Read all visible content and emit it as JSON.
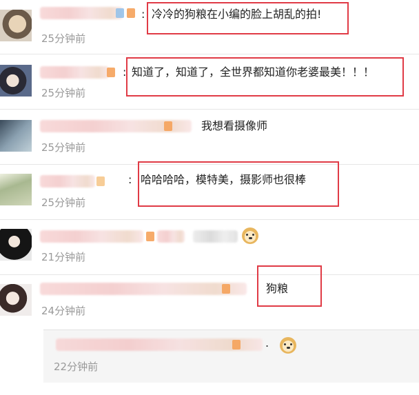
{
  "comments": [
    {
      "text": "冷冷的狗粮在小编的脸上胡乱的拍!",
      "prefix": ":",
      "time": "25分钟前",
      "highlighted": true
    },
    {
      "text": "知道了，知道了，全世界都知道你老婆最美！！！",
      "prefix": ":",
      "time": "25分钟前",
      "highlighted": true
    },
    {
      "text": "我想看摄像师",
      "prefix": "",
      "time": "25分钟前",
      "highlighted": false
    },
    {
      "text": "哈哈哈哈，模特美，摄影师也很棒",
      "prefix": ":",
      "time": "25分钟前",
      "highlighted": true
    },
    {
      "text": "",
      "prefix": "",
      "time": "21分钟前",
      "highlighted": false,
      "emoji": "doge-icon"
    },
    {
      "text": "狗粮",
      "prefix": "",
      "time": "24分钟前",
      "highlighted": true
    }
  ],
  "reply": {
    "time": "22分钟前",
    "emoji": "doge-icon"
  },
  "colors": {
    "highlight": "#e03a45",
    "time": "#999999",
    "text": "#222222"
  }
}
